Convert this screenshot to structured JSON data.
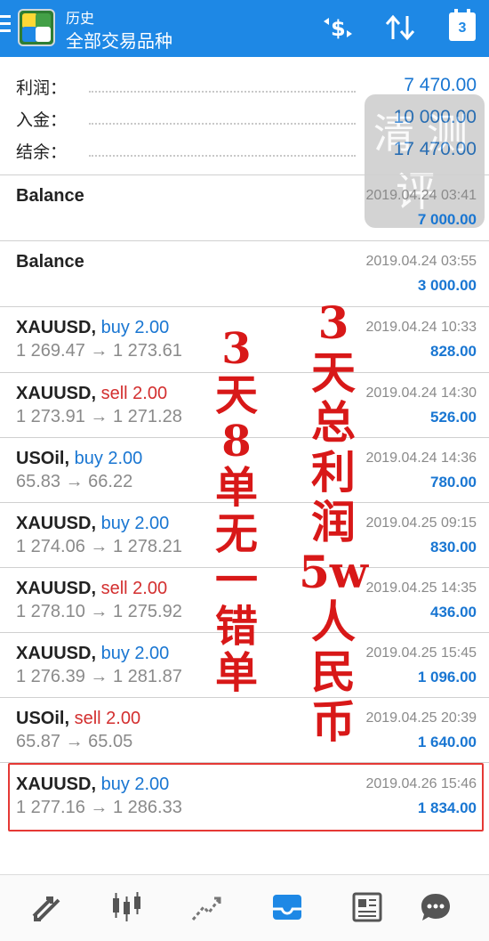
{
  "header": {
    "subtitle": "历史",
    "title": "全部交易品种",
    "calendar_day": "3"
  },
  "summary": [
    {
      "label": "利润：",
      "value": "7 470.00"
    },
    {
      "label": "入金：",
      "value": "10 000.00"
    },
    {
      "label": "结余：",
      "value": "17 470.00"
    }
  ],
  "rows": [
    {
      "symbol": "Balance",
      "side": "",
      "date": "2019.04.24 03:41",
      "profit": "7 000.00"
    },
    {
      "symbol": "Balance",
      "side": "",
      "date": "2019.04.24 03:55",
      "profit": "3 000.00"
    },
    {
      "symbol": "XAUUSD,",
      "side": "buy 2.00",
      "prices": "1 269.47 → 1 273.61",
      "date": "2019.04.24 10:33",
      "profit": "828.00"
    },
    {
      "symbol": "XAUUSD,",
      "side": "sell 2.00",
      "prices": "1 273.91 → 1 271.28",
      "date": "2019.04.24 14:30",
      "profit": "526.00"
    },
    {
      "symbol": "USOil,",
      "side": "buy 2.00",
      "prices": "65.83 → 66.22",
      "date": "2019.04.24 14:36",
      "profit": "780.00"
    },
    {
      "symbol": "XAUUSD,",
      "side": "buy 2.00",
      "prices": "1 274.06 → 1 278.21",
      "date": "2019.04.25 09:15",
      "profit": "830.00"
    },
    {
      "symbol": "XAUUSD,",
      "side": "sell 2.00",
      "prices": "1 278.10 → 1 275.92",
      "date": "2019.04.25 14:35",
      "profit": "436.00"
    },
    {
      "symbol": "XAUUSD,",
      "side": "buy 2.00",
      "prices": "1 276.39 → 1 281.87",
      "date": "2019.04.25 15:45",
      "profit": "1 096.00"
    },
    {
      "symbol": "USOil,",
      "side": "sell 2.00",
      "prices": "65.87 → 65.05",
      "date": "2019.04.25 20:39",
      "profit": "1 640.00"
    },
    {
      "symbol": "XAUUSD,",
      "side": "buy 2.00",
      "prices": "1 277.16 → 1 286.33",
      "date": "2019.04.26 15:46",
      "profit": "1 834.00"
    }
  ],
  "annotations": {
    "left_column": [
      "3",
      "天",
      "8",
      "单",
      "无",
      "一",
      "错",
      "单"
    ],
    "right_column": [
      "3",
      "天",
      "总",
      "利",
      "润",
      "5w",
      "人",
      "民",
      "币"
    ]
  },
  "colors": {
    "header_bg": "#1e88e5",
    "buy": "#1976d2",
    "sell": "#d32f2f",
    "profit": "#1976d2",
    "annotation": "#d81818"
  },
  "icons": {
    "header": [
      "menu-icon",
      "app-logo",
      "dollar-exchange-icon",
      "sort-icon",
      "calendar-icon"
    ],
    "bottom_nav": [
      "quotes-icon",
      "chart-candles-icon",
      "trade-icon",
      "history-inbox-icon",
      "news-icon",
      "messages-icon"
    ]
  },
  "bottom_nav_active": "history-inbox-icon"
}
